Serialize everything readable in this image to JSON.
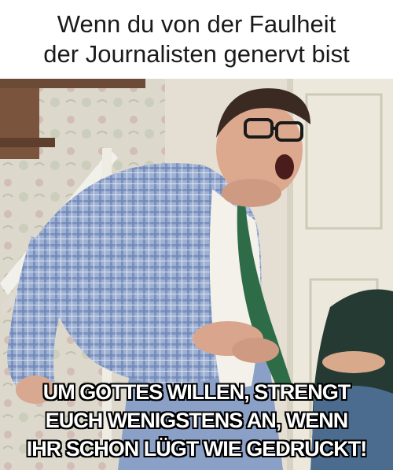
{
  "meme": {
    "top_caption": "Wenn du von der Faulheit\nder Journalisten genervt bist",
    "bottom_caption": "UM GOTTES WILLEN, STRENGT\nEUCH WENIGSTENS AN, WENN\nIHR SCHON LÜGT WIE GEDRUCKT!"
  },
  "colors": {
    "caption_text": "#1a1a1a",
    "impact_text": "#ffffff",
    "impact_outline": "#000000",
    "jacket": "#8fa3c8",
    "wall": "#e6e1d2",
    "door": "#ece8dc"
  }
}
